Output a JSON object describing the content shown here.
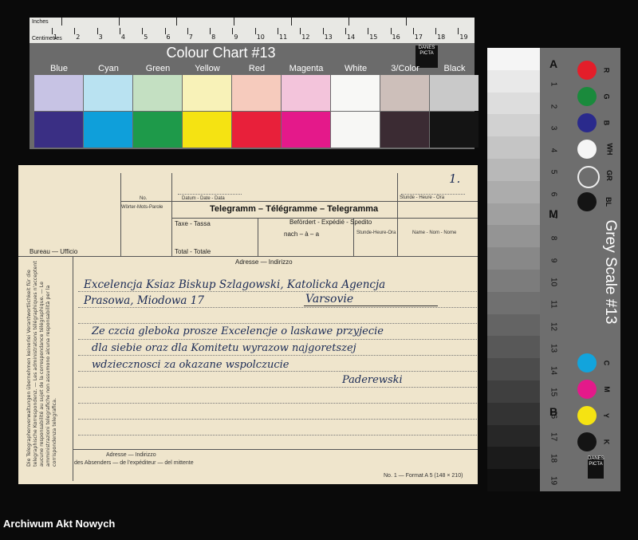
{
  "colour_chart": {
    "title": "Colour Chart #13",
    "unit_inches": "Inches",
    "unit_cm": "Centimetres",
    "ruler_inches": [
      "1",
      "2",
      "3",
      "4",
      "5",
      "6",
      "7"
    ],
    "ruler_cm": [
      "1",
      "2",
      "3",
      "4",
      "5",
      "6",
      "7",
      "8",
      "9",
      "10",
      "11",
      "12",
      "13",
      "14",
      "15",
      "16",
      "17",
      "18",
      "19"
    ],
    "logo": "DANES PICTA",
    "swatches": [
      {
        "label": "Blue",
        "light": "#c7c3e4",
        "dark": "#3a2f84"
      },
      {
        "label": "Cyan",
        "light": "#b9e2f1",
        "dark": "#0f9fda"
      },
      {
        "label": "Green",
        "light": "#c4e0c2",
        "dark": "#1e9a4a"
      },
      {
        "label": "Yellow",
        "light": "#f8f2b8",
        "dark": "#f5e312"
      },
      {
        "label": "Red",
        "light": "#f6cbbd",
        "dark": "#e8203a"
      },
      {
        "label": "Magenta",
        "light": "#f3c4db",
        "dark": "#e4198a"
      },
      {
        "label": "White",
        "light": "#f8f8f6",
        "dark": "#f7f7f5"
      },
      {
        "label": "3/Color",
        "light": "#cdbfba",
        "dark": "#3b2b33"
      },
      {
        "label": "Black",
        "light": "#c9c9c9",
        "dark": "#141414"
      }
    ]
  },
  "grey_scale": {
    "title": "Grey Scale #13",
    "letter_a": "A",
    "letter_m": "M",
    "letter_b": "B",
    "numbers": [
      "1",
      "2",
      "3",
      "4",
      "5",
      "6",
      "7",
      "8",
      "9",
      "10",
      "11",
      "12",
      "13",
      "14",
      "15",
      "16",
      "17",
      "18",
      "19"
    ],
    "logo": "DANES PICTA",
    "circles_top": [
      {
        "code": "R",
        "color": "#e41e2a"
      },
      {
        "code": "G",
        "color": "#1a8a3c"
      },
      {
        "code": "B",
        "color": "#2a2a8c"
      },
      {
        "code": "WH",
        "color": "#f5f5f5"
      },
      {
        "code": "GR",
        "color": "#6e6e6e"
      },
      {
        "code": "BL",
        "color": "#141414"
      }
    ],
    "circles_bottom": [
      {
        "code": "C",
        "color": "#12a4dc"
      },
      {
        "code": "M",
        "color": "#e4198a"
      },
      {
        "code": "Y",
        "color": "#f5e312"
      },
      {
        "code": "K",
        "color": "#141414"
      }
    ]
  },
  "telegram": {
    "page_number": "1.",
    "no": "No.",
    "worter": "Wörter-Mots-Parole",
    "datum": "Datum - Date - Data",
    "stunde": "Stunde - Heure - Ora",
    "title": "Telegramm – Télégramme – Telegramma",
    "taxe": "Taxe - Tassa",
    "befordert": "Befördert - Expédié - Spedito",
    "nach": "nach – à – a",
    "stunde2": "Stunde-Heure-Ora",
    "name": "Name - Nom - Nome",
    "bureau": "Bureau — Ufficio",
    "total": "Total - Totale",
    "adresse": "Adresse — Indirizzo",
    "vertical_text": "Die Telegraphenverwaltungen übernehmen keinerlei Verantwortlichkeit für die telegraphische Korrespondenz. — Les administrations télégraphiques n'acceptent aucune responsabilité au sujet de la correspondance télégraphique. — Le amministrazioni telegrafiche non assumono alcuna responsabilità per la corrispondenza telegrafica.",
    "address_line1": "Excelencja Ksiaz Biskup Szlagowski, Katolicka Agencja",
    "address_line2": "Prasowa, Miodowa 17",
    "city": "Varsovie",
    "msg_line1": "Ze czcia gleboka prosze Excelencje o laskawe przyjecie",
    "msg_line2": "dla siebie oraz dla Komitetu wyrazow najgoretszej",
    "msg_line3": "wdziecznosci za okazane wspolczucie",
    "signature": "Paderewski",
    "sender_label1": "Adresse — Indirizzo",
    "sender_label2": "des Absenders — de l'expéditeur — del mittente",
    "footer": "No. 1 — Format A 5 (148 × 210)"
  },
  "archive_label": "Archiwum Akt Nowych"
}
